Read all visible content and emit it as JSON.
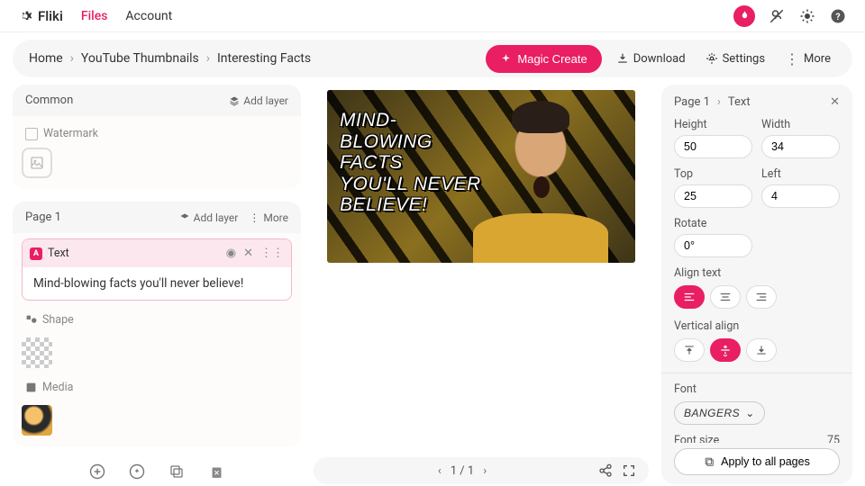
{
  "brand": "Fliki",
  "nav": {
    "files": "Files",
    "account": "Account"
  },
  "breadcrumbs": [
    "Home",
    "YouTube Thumbnails",
    "Interesting Facts"
  ],
  "actions": {
    "magic": "Magic Create",
    "download": "Download",
    "settings": "Settings",
    "more": "More"
  },
  "left": {
    "common": {
      "title": "Common",
      "addLayer": "Add layer",
      "watermark": "Watermark"
    },
    "page": {
      "title": "Page 1",
      "addLayer": "Add layer",
      "more": "More",
      "textLabel": "Text",
      "textValue": "Mind-blowing facts you'll never believe!",
      "shapeLabel": "Shape",
      "mediaLabel": "Media"
    }
  },
  "canvas": {
    "text": "Mind-\nblowing\nfacts\nyou'll never\nbelieve!"
  },
  "pager": {
    "page": "1 / 1"
  },
  "right": {
    "crumb1": "Page 1",
    "crumb2": "Text",
    "height": {
      "label": "Height",
      "value": "50"
    },
    "width": {
      "label": "Width",
      "value": "34"
    },
    "top": {
      "label": "Top",
      "value": "25"
    },
    "left": {
      "label": "Left",
      "value": "4"
    },
    "rotate": {
      "label": "Rotate",
      "value": "0°"
    },
    "alignText": "Align text",
    "vAlign": "Vertical align",
    "font": {
      "label": "Font",
      "value": "Bangers"
    },
    "fontSize": {
      "label": "Font size",
      "value": "75"
    },
    "apply": "Apply to all pages"
  }
}
